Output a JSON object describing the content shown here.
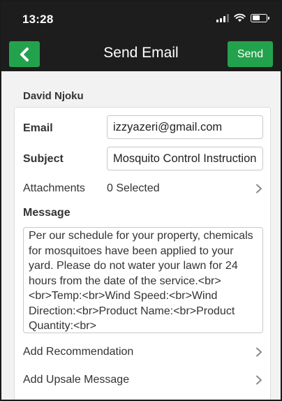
{
  "status_bar": {
    "time": "13:28"
  },
  "nav": {
    "title": "Send Email",
    "send_label": "Send"
  },
  "recipient": {
    "name": "David Njoku"
  },
  "form": {
    "email": {
      "label": "Email",
      "value": "izzyazeri@gmail.com"
    },
    "subject": {
      "label": "Subject",
      "value": "Mosquito Control Instructions"
    },
    "attachments": {
      "label": "Attachments",
      "value": "0 Selected"
    },
    "message": {
      "label": "Message",
      "body": "Per our schedule for your property, chemicals for mosquitoes have been applied to your yard. Please do not water your lawn for 24 hours from the date of the service.<br><br>Temp:<br>Wind Speed:<br>Wind Direction:<br>Product Name:<br>Product Quantity:<br>"
    },
    "add_recommendation": "Add Recommendation",
    "add_upsale_message": "Add Upsale Message"
  },
  "colors": {
    "accent_green": "#23a24d",
    "bar_background": "#1d1d1d",
    "page_background": "#f2f2f2"
  },
  "icons": {
    "back": "chevron-left-icon",
    "row_arrow": "chevron-right-icon",
    "signal": "cellular-signal-icon",
    "wifi": "wifi-icon",
    "battery": "battery-icon"
  }
}
